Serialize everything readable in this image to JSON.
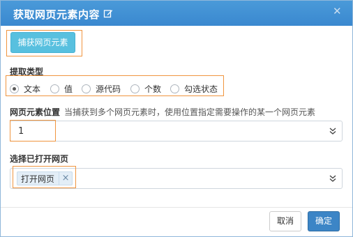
{
  "dialog": {
    "title": "获取网页元素内容",
    "edit_icon": "edit-icon",
    "close_icon": "close-icon",
    "close_glyph": "✕"
  },
  "capture_button": {
    "label": "捕获网页元素"
  },
  "extract_type": {
    "label": "提取类型",
    "options": [
      {
        "label": "文本",
        "checked": true
      },
      {
        "label": "值",
        "checked": false
      },
      {
        "label": "源代码",
        "checked": false
      },
      {
        "label": "个数",
        "checked": false
      },
      {
        "label": "勾选状态",
        "checked": false
      }
    ]
  },
  "element_position": {
    "label": "网页元素位置",
    "hint": "当捕获到多个网页元素时，使用位置指定需要操作的某一个网页元素",
    "value": "1"
  },
  "opened_page": {
    "label": "选择已打开网页",
    "tag_label": "打开网页",
    "tag_close_glyph": "×"
  },
  "footer": {
    "cancel_label": "取消",
    "ok_label": "确定"
  },
  "colors": {
    "header": "#3a88cf",
    "capture_button": "#58c0df",
    "highlight_border": "#f0953f",
    "ok_button": "#3c85c6"
  }
}
